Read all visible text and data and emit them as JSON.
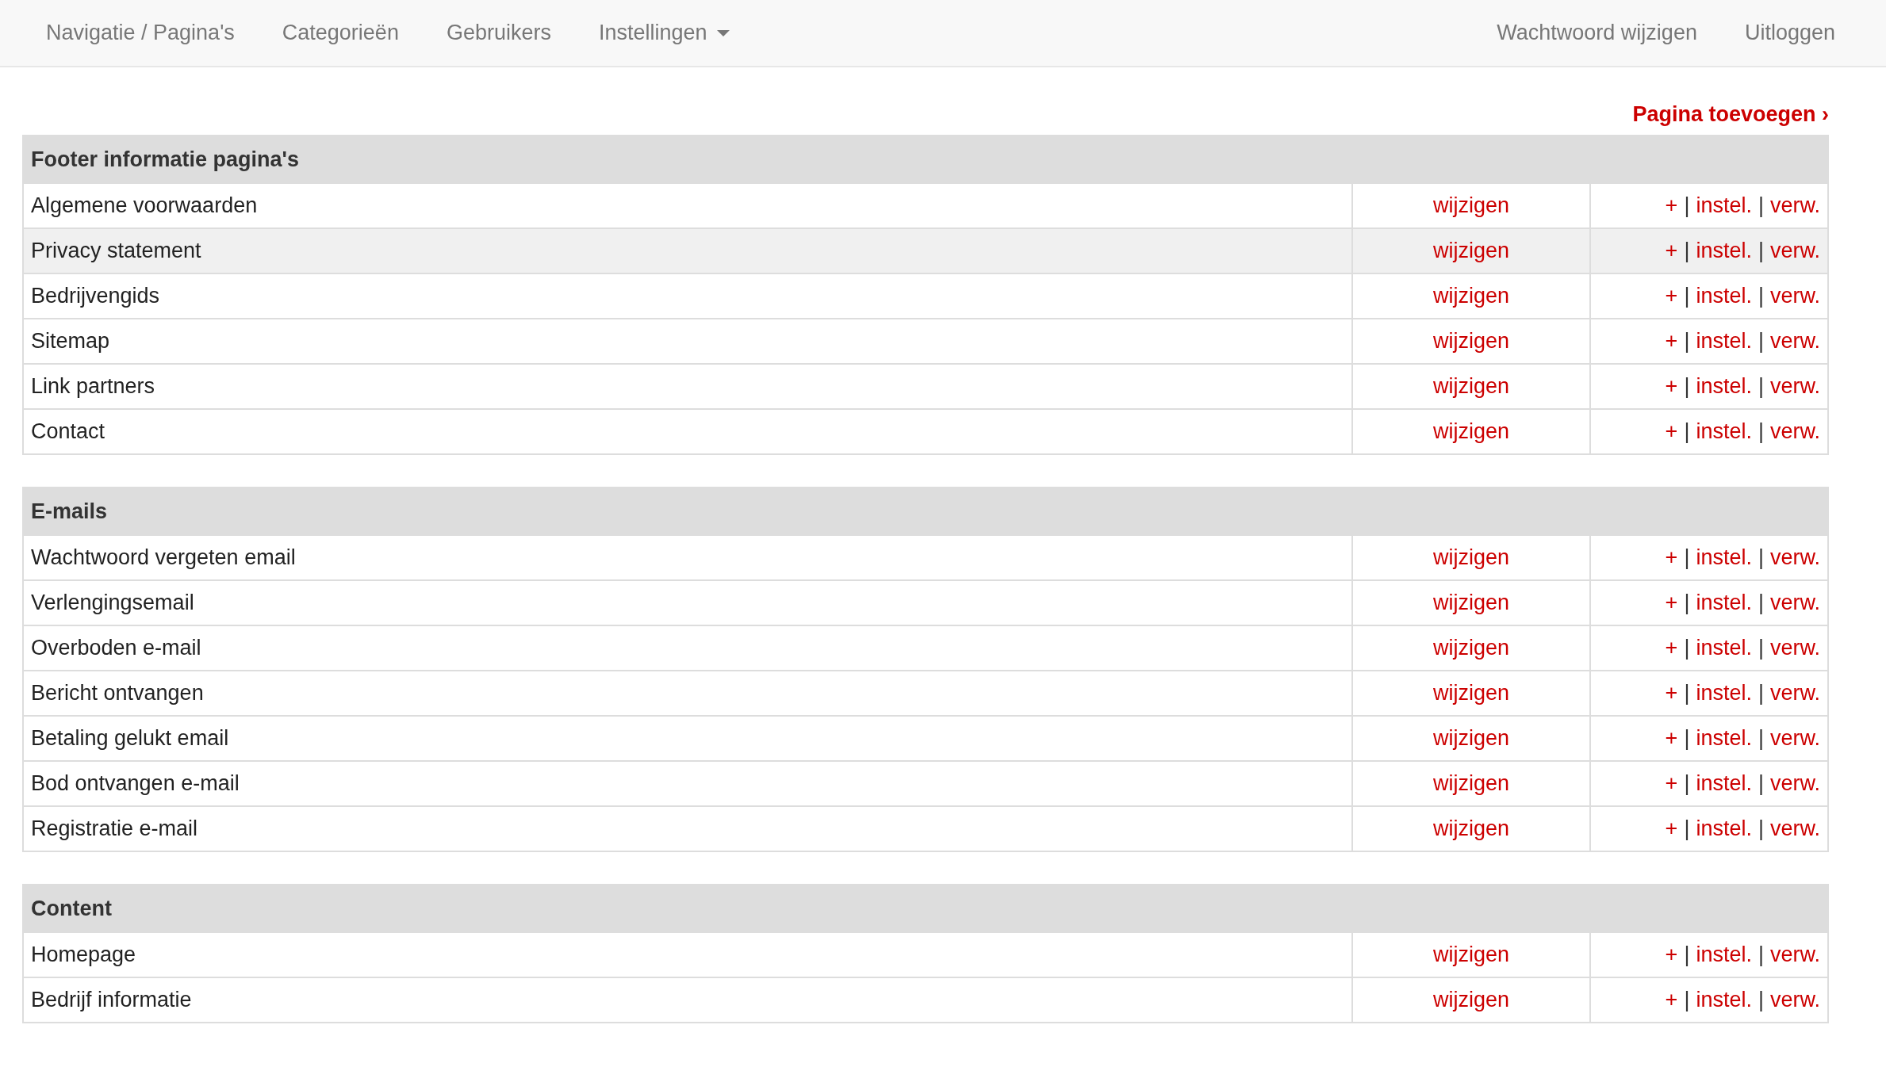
{
  "navbar": {
    "left": [
      {
        "label": "Navigatie / Pagina's",
        "kind": "link"
      },
      {
        "label": "Categorieën",
        "kind": "link"
      },
      {
        "label": "Gebruikers",
        "kind": "link"
      },
      {
        "label": "Instellingen",
        "kind": "dropdown"
      }
    ],
    "right": [
      {
        "label": "Wachtwoord wijzigen"
      },
      {
        "label": "Uitloggen"
      }
    ]
  },
  "add_link": {
    "label": "Pagina toevoegen ›"
  },
  "sections": [
    {
      "title": "Footer informatie pagina's",
      "rows": [
        {
          "name": "Algemene voorwaarden",
          "highlighted": false,
          "edit": "wijzigen",
          "actions": [
            {
              "kind": "link",
              "label": "+"
            },
            {
              "kind": "separator",
              "label": "|"
            },
            {
              "kind": "link",
              "label": "instel."
            },
            {
              "kind": "separator",
              "label": "|"
            },
            {
              "kind": "link",
              "label": "verw."
            }
          ]
        },
        {
          "name": "Privacy statement",
          "highlighted": true,
          "edit": "wijzigen",
          "actions": [
            {
              "kind": "link",
              "label": "+"
            },
            {
              "kind": "separator",
              "label": "|"
            },
            {
              "kind": "link",
              "label": "instel."
            },
            {
              "kind": "separator",
              "label": "|"
            },
            {
              "kind": "link",
              "label": "verw."
            }
          ]
        },
        {
          "name": "Bedrijvengids",
          "highlighted": false,
          "edit": "wijzigen",
          "actions": [
            {
              "kind": "link",
              "label": "+"
            },
            {
              "kind": "separator",
              "label": "|"
            },
            {
              "kind": "link",
              "label": "instel."
            },
            {
              "kind": "separator",
              "label": "|"
            },
            {
              "kind": "link",
              "label": "verw."
            }
          ]
        },
        {
          "name": "Sitemap",
          "highlighted": false,
          "edit": "wijzigen",
          "actions": [
            {
              "kind": "link",
              "label": "+"
            },
            {
              "kind": "separator",
              "label": "|"
            },
            {
              "kind": "link",
              "label": "instel."
            },
            {
              "kind": "separator",
              "label": "|"
            },
            {
              "kind": "link",
              "label": "verw."
            }
          ]
        },
        {
          "name": "Link partners",
          "highlighted": false,
          "edit": "wijzigen",
          "actions": [
            {
              "kind": "link",
              "label": "+"
            },
            {
              "kind": "separator",
              "label": "|"
            },
            {
              "kind": "link",
              "label": "instel."
            },
            {
              "kind": "separator",
              "label": "|"
            },
            {
              "kind": "link",
              "label": "verw."
            }
          ]
        },
        {
          "name": "Contact",
          "highlighted": false,
          "edit": "wijzigen",
          "actions": [
            {
              "kind": "link",
              "label": "+"
            },
            {
              "kind": "separator",
              "label": "|"
            },
            {
              "kind": "link",
              "label": "instel."
            },
            {
              "kind": "separator",
              "label": "|"
            },
            {
              "kind": "link",
              "label": "verw."
            }
          ]
        }
      ]
    },
    {
      "title": "E-mails",
      "rows": [
        {
          "name": "Wachtwoord vergeten email",
          "highlighted": false,
          "edit": "wijzigen",
          "actions": [
            {
              "kind": "link",
              "label": "+"
            },
            {
              "kind": "separator",
              "label": "|"
            },
            {
              "kind": "link",
              "label": "instel."
            },
            {
              "kind": "separator",
              "label": "|"
            },
            {
              "kind": "link",
              "label": "verw."
            }
          ]
        },
        {
          "name": "Verlengingsemail",
          "highlighted": false,
          "edit": "wijzigen",
          "actions": [
            {
              "kind": "link",
              "label": "+"
            },
            {
              "kind": "separator",
              "label": "|"
            },
            {
              "kind": "link",
              "label": "instel."
            },
            {
              "kind": "separator",
              "label": "|"
            },
            {
              "kind": "link",
              "label": "verw."
            }
          ]
        },
        {
          "name": "Overboden e-mail",
          "highlighted": false,
          "edit": "wijzigen",
          "actions": [
            {
              "kind": "link",
              "label": "+"
            },
            {
              "kind": "separator",
              "label": "|"
            },
            {
              "kind": "link",
              "label": "instel."
            },
            {
              "kind": "separator",
              "label": "|"
            },
            {
              "kind": "link",
              "label": "verw."
            }
          ]
        },
        {
          "name": "Bericht ontvangen",
          "highlighted": false,
          "edit": "wijzigen",
          "actions": [
            {
              "kind": "link",
              "label": "+"
            },
            {
              "kind": "separator",
              "label": "|"
            },
            {
              "kind": "link",
              "label": "instel."
            },
            {
              "kind": "separator",
              "label": "|"
            },
            {
              "kind": "link",
              "label": "verw."
            }
          ]
        },
        {
          "name": "Betaling gelukt email",
          "highlighted": false,
          "edit": "wijzigen",
          "actions": [
            {
              "kind": "link",
              "label": "+"
            },
            {
              "kind": "separator",
              "label": "|"
            },
            {
              "kind": "link",
              "label": "instel."
            },
            {
              "kind": "separator",
              "label": "|"
            },
            {
              "kind": "link",
              "label": "verw."
            }
          ]
        },
        {
          "name": "Bod ontvangen e-mail",
          "highlighted": false,
          "edit": "wijzigen",
          "actions": [
            {
              "kind": "link",
              "label": "+"
            },
            {
              "kind": "separator",
              "label": "|"
            },
            {
              "kind": "link",
              "label": "instel."
            },
            {
              "kind": "separator",
              "label": "|"
            },
            {
              "kind": "link",
              "label": "verw."
            }
          ]
        },
        {
          "name": "Registratie e-mail",
          "highlighted": false,
          "edit": "wijzigen",
          "actions": [
            {
              "kind": "link",
              "label": "+"
            },
            {
              "kind": "separator",
              "label": "|"
            },
            {
              "kind": "link",
              "label": "instel."
            },
            {
              "kind": "separator",
              "label": "|"
            },
            {
              "kind": "link",
              "label": "verw."
            }
          ]
        }
      ]
    },
    {
      "title": "Content",
      "rows": [
        {
          "name": "Homepage",
          "highlighted": false,
          "edit": "wijzigen",
          "actions": [
            {
              "kind": "link",
              "label": "+"
            },
            {
              "kind": "separator",
              "label": "|"
            },
            {
              "kind": "link",
              "label": "instel."
            },
            {
              "kind": "separator",
              "label": "|"
            },
            {
              "kind": "link",
              "label": "verw."
            }
          ]
        },
        {
          "name": "Bedrijf informatie",
          "highlighted": false,
          "edit": "wijzigen",
          "actions": [
            {
              "kind": "link",
              "label": "+"
            },
            {
              "kind": "separator",
              "label": "|"
            },
            {
              "kind": "link",
              "label": "instel."
            },
            {
              "kind": "separator",
              "label": "|"
            },
            {
              "kind": "link",
              "label": "verw."
            }
          ]
        }
      ]
    }
  ]
}
